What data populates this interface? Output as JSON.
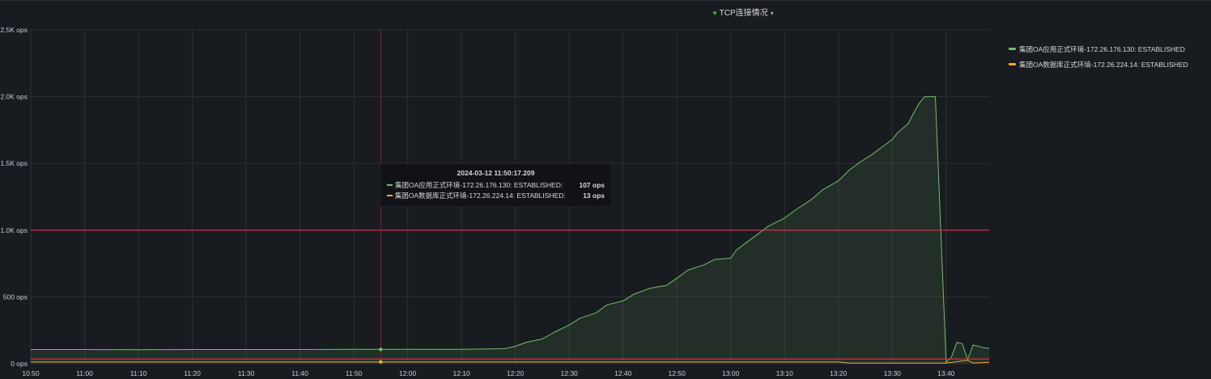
{
  "panel": {
    "title": "TCP连接情况",
    "icon": "heart-icon",
    "dropdown_icon": "caret-down-icon"
  },
  "tooltip": {
    "time": "2024-03-12 11:50:17.209",
    "rows": [
      {
        "name": "集团OA应用正式环境-172.26.176.130: ESTABLISHED:",
        "value": "107 ops",
        "color": "#73bf69"
      },
      {
        "name": "集团OA数据库正式环境-172.26.224.14: ESTABLISHED:",
        "value": "13 ops",
        "color": "#f2a93b"
      }
    ]
  },
  "chart_data": {
    "type": "line",
    "title": "TCP连接情况",
    "ylim": [
      0,
      2500
    ],
    "yticks": [
      {
        "value": 0,
        "label": "0 ops"
      },
      {
        "value": 500,
        "label": "500 ops"
      },
      {
        "value": 1000,
        "label": "1.0K ops"
      },
      {
        "value": 1500,
        "label": "1.5K ops"
      },
      {
        "value": 2000,
        "label": "2.0K ops"
      },
      {
        "value": 2500,
        "label": "2.5K ops"
      }
    ],
    "xlim": [
      "10:50",
      "13:48"
    ],
    "xticks": [
      "10:50",
      "11:00",
      "11:10",
      "11:20",
      "11:30",
      "11:40",
      "11:50",
      "12:00",
      "12:10",
      "12:20",
      "12:30",
      "12:40",
      "12:50",
      "13:00",
      "13:10",
      "13:20",
      "13:30",
      "13:40"
    ],
    "thresholds": [
      {
        "value": 1000,
        "color": "#e02f44"
      },
      {
        "value": 35,
        "color": "#e02f44"
      }
    ],
    "crosshair_time": "11:55",
    "grid": true,
    "legend_position": "right",
    "series": [
      {
        "name": "集团OA应用正式环境-172.26.176.130: ESTABLISHED",
        "color": "#73bf69",
        "fill": true,
        "points": [
          [
            "10:50",
            106
          ],
          [
            "11:00",
            106
          ],
          [
            "11:10",
            105
          ],
          [
            "11:20",
            106
          ],
          [
            "11:30",
            106
          ],
          [
            "11:40",
            106
          ],
          [
            "11:50",
            107
          ],
          [
            "11:55",
            107
          ],
          [
            "12:00",
            107
          ],
          [
            "12:10",
            108
          ],
          [
            "12:18",
            112
          ],
          [
            "12:20",
            130
          ],
          [
            "12:22",
            160
          ],
          [
            "12:25",
            185
          ],
          [
            "12:27",
            230
          ],
          [
            "12:30",
            290
          ],
          [
            "12:32",
            340
          ],
          [
            "12:35",
            380
          ],
          [
            "12:37",
            440
          ],
          [
            "12:40",
            470
          ],
          [
            "12:42",
            520
          ],
          [
            "12:45",
            565
          ],
          [
            "12:47",
            580
          ],
          [
            "12:48",
            585
          ],
          [
            "12:50",
            640
          ],
          [
            "12:52",
            700
          ],
          [
            "12:55",
            740
          ],
          [
            "12:57",
            780
          ],
          [
            "13:00",
            790
          ],
          [
            "13:01",
            850
          ],
          [
            "13:03",
            910
          ],
          [
            "13:05",
            970
          ],
          [
            "13:07",
            1030
          ],
          [
            "13:10",
            1090
          ],
          [
            "13:12",
            1150
          ],
          [
            "13:15",
            1230
          ],
          [
            "13:17",
            1300
          ],
          [
            "13:20",
            1370
          ],
          [
            "13:22",
            1450
          ],
          [
            "13:24",
            1510
          ],
          [
            "13:26",
            1560
          ],
          [
            "13:28",
            1620
          ],
          [
            "13:30",
            1680
          ],
          [
            "13:31",
            1730
          ],
          [
            "13:33",
            1800
          ],
          [
            "13:34",
            1880
          ],
          [
            "13:35",
            1950
          ],
          [
            "13:36",
            2000
          ],
          [
            "13:38",
            2000
          ],
          [
            "13:40",
            10
          ],
          [
            "13:41",
            50
          ],
          [
            "13:42",
            160
          ],
          [
            "13:43",
            150
          ],
          [
            "13:44",
            30
          ],
          [
            "13:45",
            140
          ],
          [
            "13:47",
            120
          ],
          [
            "13:48",
            115
          ]
        ]
      },
      {
        "name": "集团OA数据库正式环境-172.26.224.14: ESTABLISHED",
        "color": "#f2a93b",
        "fill": false,
        "points": [
          [
            "10:50",
            13
          ],
          [
            "11:10",
            13
          ],
          [
            "11:30",
            13
          ],
          [
            "11:50",
            13
          ],
          [
            "12:10",
            13
          ],
          [
            "12:30",
            13
          ],
          [
            "12:50",
            13
          ],
          [
            "13:10",
            13
          ],
          [
            "13:20",
            13
          ],
          [
            "13:22",
            5
          ],
          [
            "13:30",
            5
          ],
          [
            "13:40",
            5
          ],
          [
            "13:42",
            15
          ],
          [
            "13:44",
            25
          ],
          [
            "13:45",
            5
          ],
          [
            "13:48",
            10
          ]
        ]
      }
    ]
  }
}
